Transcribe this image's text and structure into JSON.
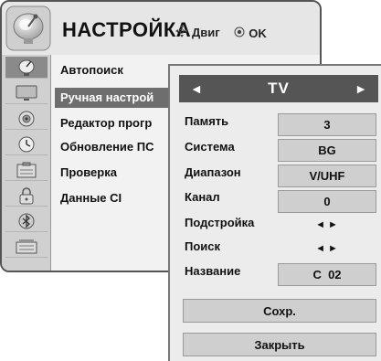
{
  "main_menu": {
    "title": "НАСТРОЙКА",
    "hints": [
      {
        "icon": "move-arrows-icon",
        "label": "Двиг"
      },
      {
        "icon": "ok-button-icon",
        "label": "OK"
      }
    ],
    "side_icons": [
      {
        "name": "satellite-dish-icon",
        "active": true
      },
      {
        "name": "tv-screen-icon",
        "active": false
      },
      {
        "name": "speaker-audio-icon",
        "active": false
      },
      {
        "name": "clock-icon",
        "active": false
      },
      {
        "name": "checklist-icon",
        "active": false
      },
      {
        "name": "lock-icon",
        "active": false
      },
      {
        "name": "bluetooth-icon",
        "active": false
      },
      {
        "name": "usb-media-icon",
        "active": false
      }
    ],
    "items": [
      {
        "label": "Автопоиск",
        "selected": false
      },
      {
        "label": "Ручная настрой",
        "selected": true
      },
      {
        "label": "Редактор прогр",
        "selected": false
      },
      {
        "label": "Обновление ПС",
        "selected": false
      },
      {
        "label": "Проверка",
        "selected": false
      },
      {
        "label": "Данные CI",
        "selected": false
      }
    ]
  },
  "dialog": {
    "header": {
      "left_arrow": "◄",
      "title": "TV",
      "right_arrow": "►"
    },
    "rows": [
      {
        "label": "Память",
        "value": "3"
      },
      {
        "label": "Система",
        "value": "BG"
      },
      {
        "label": "Диапазон",
        "value": "V/UHF"
      },
      {
        "label": "Канал",
        "value": "0"
      }
    ],
    "steppers": [
      {
        "label": "Подстройка",
        "left": "◄",
        "right": "►"
      },
      {
        "label": "Поиск",
        "left": "◄",
        "right": "►"
      }
    ],
    "name_row": {
      "label": "Название",
      "value": "C  02"
    },
    "save_label": "Сохр.",
    "close_label": "Закрыть"
  }
}
